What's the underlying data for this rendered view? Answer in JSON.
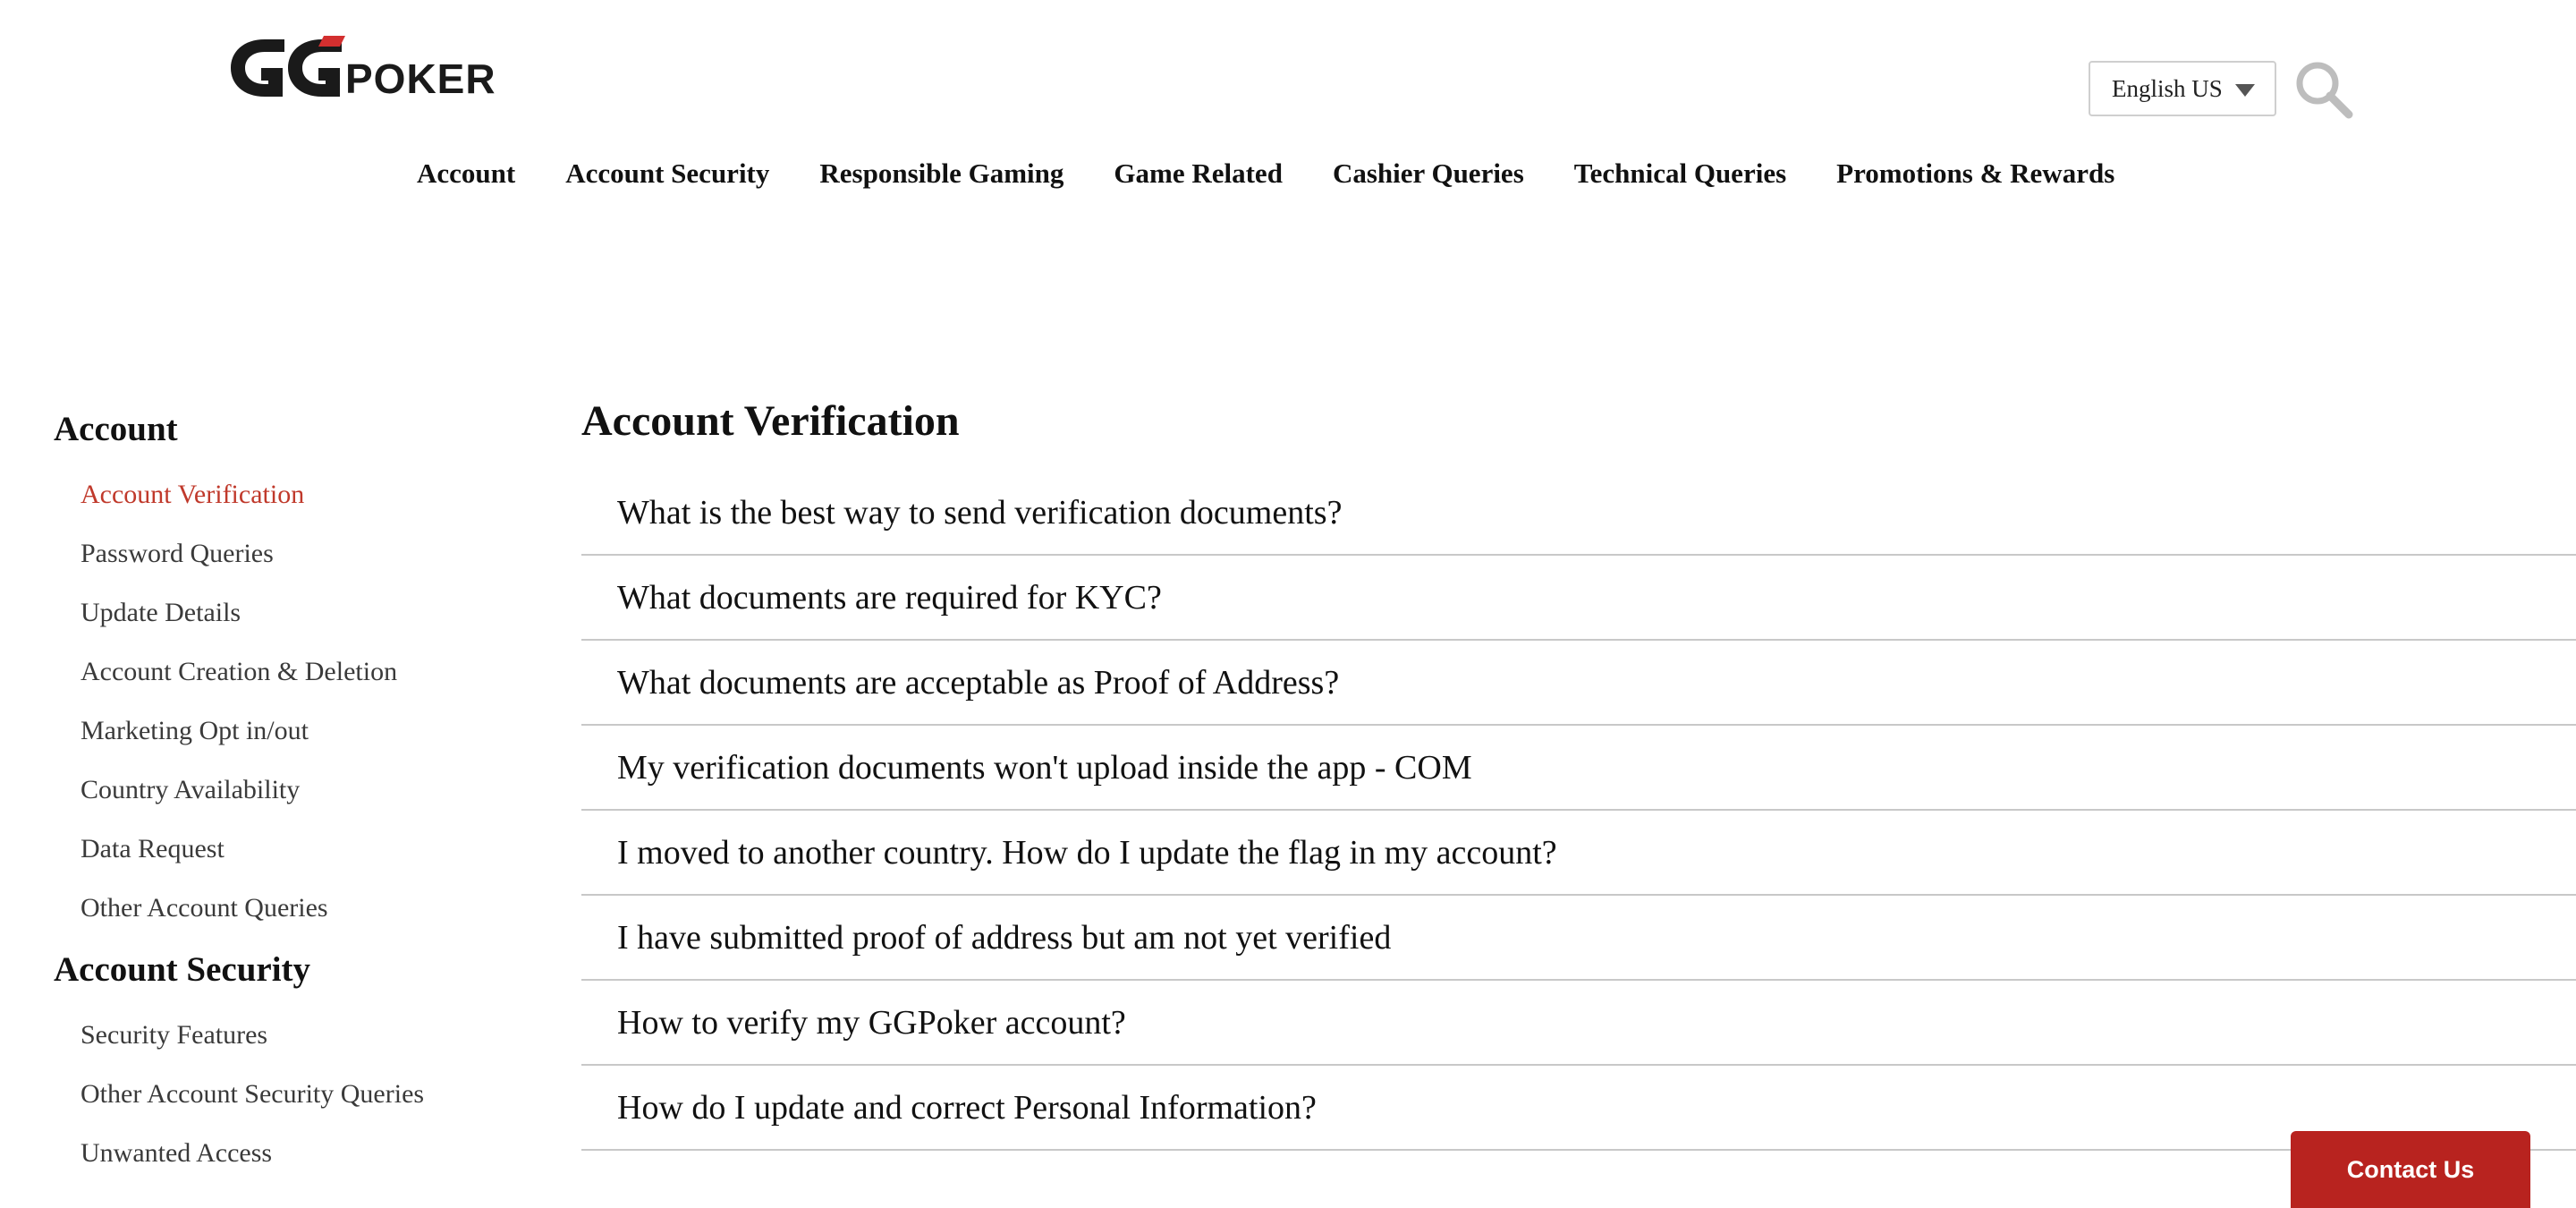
{
  "header": {
    "logo_text": "GGPOKER",
    "language": "English US",
    "nav": [
      {
        "label": "Account"
      },
      {
        "label": "Account Security"
      },
      {
        "label": "Responsible Gaming"
      },
      {
        "label": "Game Related"
      },
      {
        "label": "Cashier Queries"
      },
      {
        "label": "Technical Queries"
      },
      {
        "label": "Promotions & Rewards"
      }
    ]
  },
  "sidebar": {
    "groups": [
      {
        "heading": "Account",
        "items": [
          {
            "label": "Account Verification",
            "active": true
          },
          {
            "label": "Password Queries"
          },
          {
            "label": "Update Details"
          },
          {
            "label": "Account Creation & Deletion"
          },
          {
            "label": "Marketing Opt in/out"
          },
          {
            "label": "Country Availability"
          },
          {
            "label": "Data Request"
          },
          {
            "label": "Other Account Queries"
          }
        ]
      },
      {
        "heading": "Account Security",
        "items": [
          {
            "label": "Security Features"
          },
          {
            "label": "Other Account Security Queries"
          },
          {
            "label": "Unwanted Access"
          }
        ]
      }
    ]
  },
  "main": {
    "title": "Account Verification",
    "questions": [
      "What is the best way to send verification documents?",
      "What documents are required for KYC?",
      "What documents are acceptable as Proof of Address?",
      "My verification documents won't upload inside the app - COM",
      "I moved to another country. How do I update the flag in my account?",
      "I have submitted proof of address but am not yet verified",
      "How to verify my GGPoker account?",
      "How do I update and correct Personal Information?"
    ]
  },
  "contact": {
    "label": "Contact Us"
  },
  "colors": {
    "accent": "#c0392b",
    "button": "#b8231f",
    "logo_red": "#d32f2f"
  }
}
